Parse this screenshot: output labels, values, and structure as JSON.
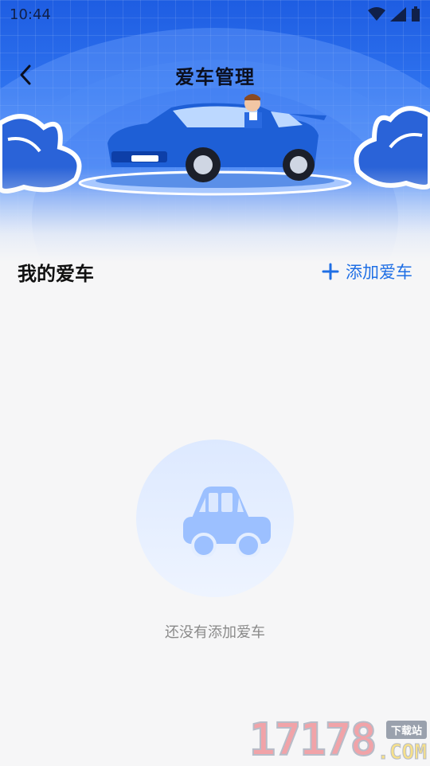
{
  "status_bar": {
    "time": "10:44"
  },
  "header": {
    "title": "爱车管理",
    "back_icon": "chevron-left-icon"
  },
  "section": {
    "title": "我的爱车",
    "add_label": "添加爱车",
    "add_icon": "plus-icon"
  },
  "empty_state": {
    "message": "还没有添加爱车",
    "icon": "car-icon"
  },
  "watermark": {
    "number": "17178",
    "tag": "下载站",
    "suffix": ".COM"
  },
  "colors": {
    "accent": "#1f6fe5",
    "banner_blue": "#2f73ef",
    "background": "#f6f6f7",
    "empty_icon": "#9cc0ff"
  }
}
